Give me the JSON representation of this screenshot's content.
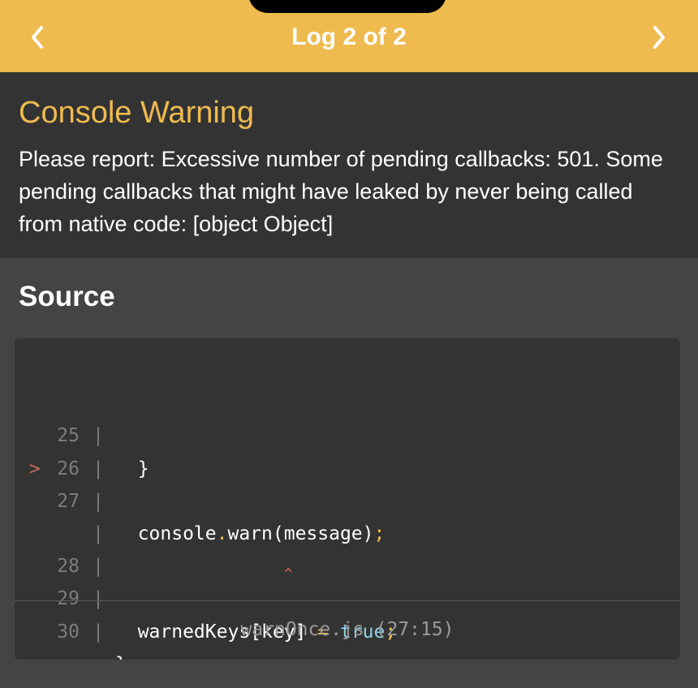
{
  "header": {
    "title": "Log 2 of 2",
    "prev_icon": "chevron-left-icon",
    "next_icon": "chevron-right-icon",
    "background": "#efbb4f"
  },
  "warning": {
    "title": "Console Warning",
    "message": "Please report: Excessive number of pending callbacks: 501. Some pending callbacks that might have leaked by never being called from native code: [object Object]",
    "title_color": "#efbb4f"
  },
  "source": {
    "title": "Source",
    "lines": [
      {
        "marker": "",
        "number": "25",
        "pipe": "|",
        "code": "  }"
      },
      {
        "marker": "",
        "number": "26",
        "pipe": "|",
        "code": ""
      },
      {
        "marker": ">",
        "number": "27",
        "pipe": "|",
        "code": "  console.warn(message);"
      },
      {
        "marker": "",
        "number": "",
        "pipe": "|",
        "code": "               ^"
      },
      {
        "marker": "",
        "number": "28",
        "pipe": "|",
        "code": ""
      },
      {
        "marker": "",
        "number": "29",
        "pipe": "|",
        "code": "  warnedKeys[key] = true;"
      },
      {
        "marker": "",
        "number": "30",
        "pipe": "|",
        "code": "}"
      }
    ],
    "file_ref": "warnOnce.js (27:15)"
  },
  "colors": {
    "accent": "#efbb4f",
    "keyword_true": "#8fd3e8",
    "error_marker": "#c26b5b",
    "panel": "#333333",
    "background": "#444444"
  }
}
